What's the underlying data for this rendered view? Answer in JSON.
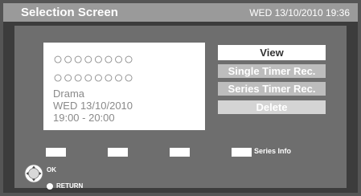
{
  "header": {
    "title": "Selection Screen",
    "datetime": "WED 13/10/2010 19:36"
  },
  "program_card": {
    "placeholder_line_1": "○○○○○○○○",
    "placeholder_line_2": "○○○○○○○○",
    "genre": "Drama",
    "date": "WED 13/10/2010",
    "time": "19:00 - 20:00"
  },
  "menu": {
    "items": [
      {
        "label": "View",
        "selected": true
      },
      {
        "label": "Single Timer Rec."
      },
      {
        "label": "Series Timer Rec."
      },
      {
        "label": "Delete"
      }
    ]
  },
  "color_keys": {
    "fourth_label": "Series Info"
  },
  "remote_help": {
    "ok_label": "OK",
    "return_label": "RETURN"
  },
  "colors": {
    "background": "#555555",
    "frame": "#3c3c3c",
    "title_bar": "#9a9a9a",
    "content_area": "#6e6e6e",
    "menu_selected": "#ffffff",
    "menu_item": "#bdbdbd",
    "text_on_dark": "#ffffff"
  },
  "icons": [
    "dpad-icon",
    "return-button-icon"
  ]
}
